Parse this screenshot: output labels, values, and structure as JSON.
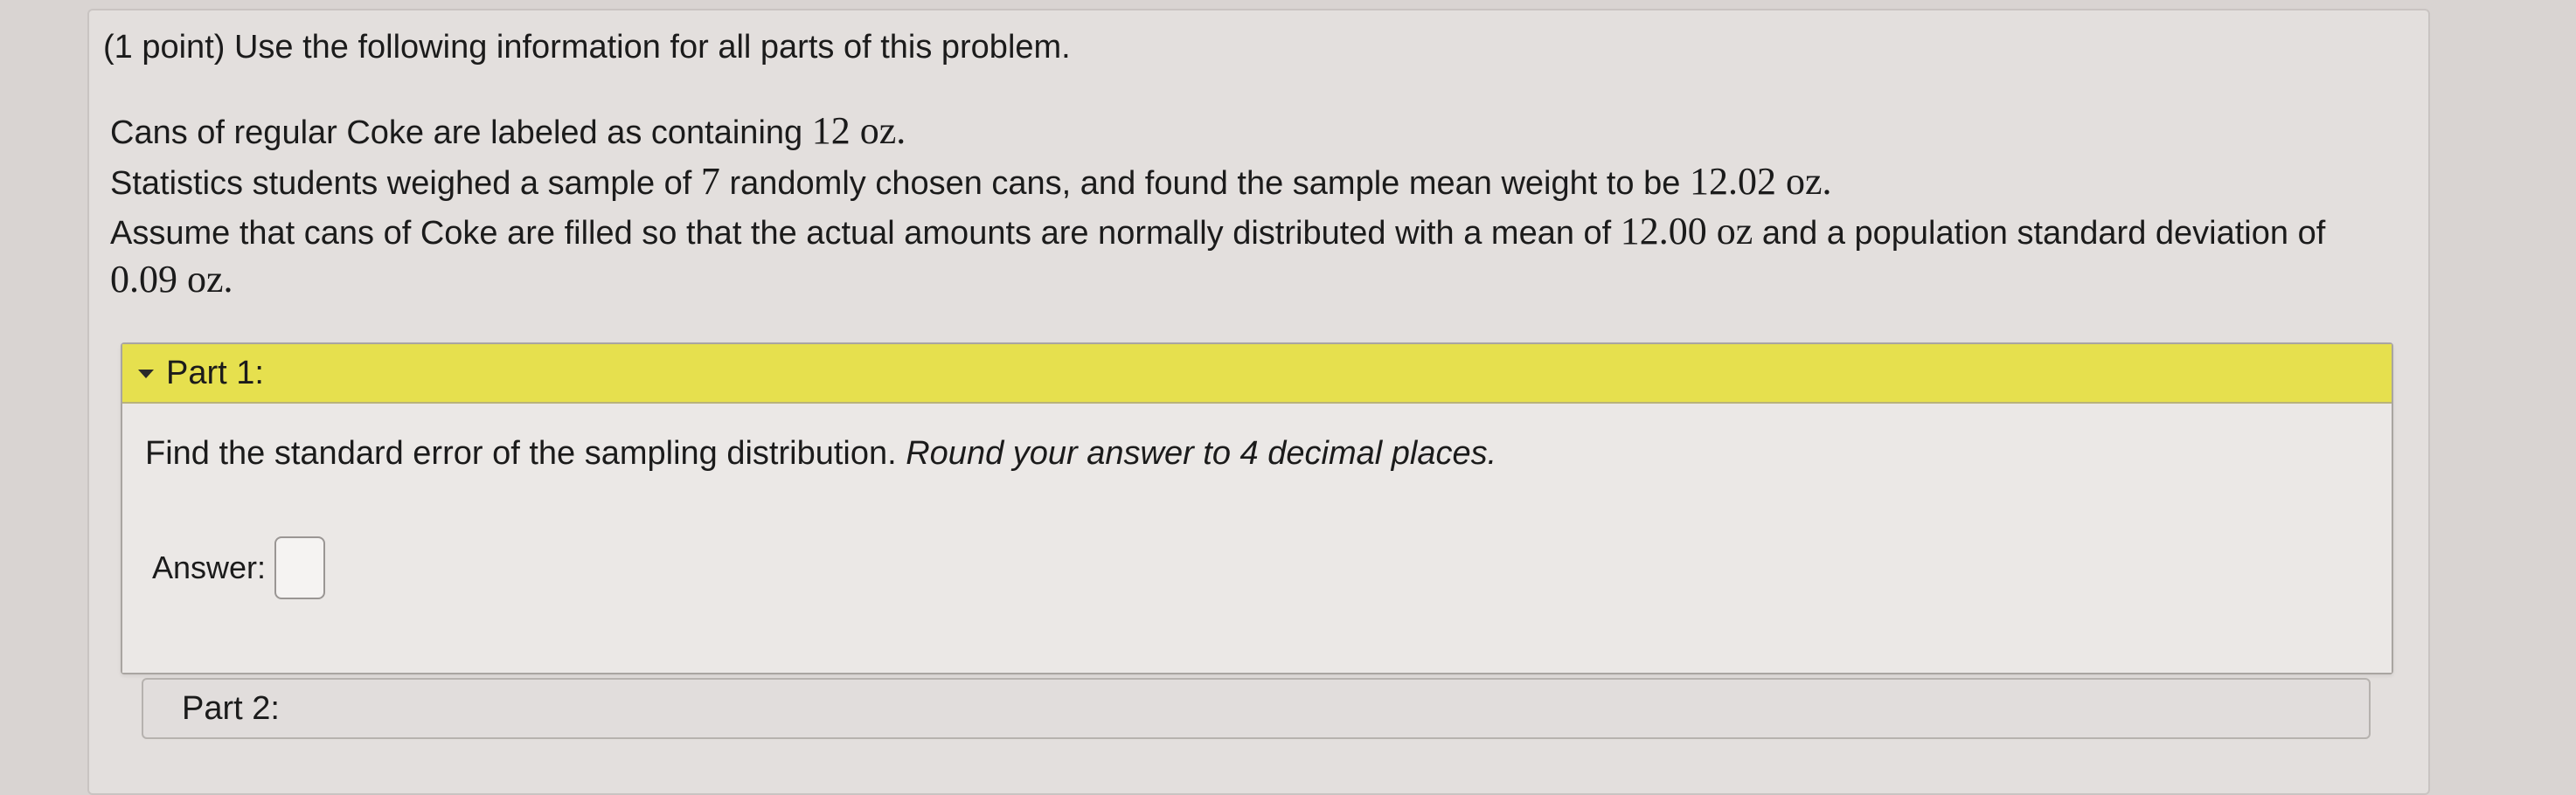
{
  "problem": {
    "intro": "(1 point) Use the following information for all parts of this problem.",
    "line1": {
      "text": "Cans of regular Coke are labeled as containing ",
      "value": "12 oz."
    },
    "line2": {
      "text_a": "Statistics students weighed a sample of ",
      "n": "7",
      "text_b": " randomly chosen cans, and found the sample mean weight to be ",
      "mean": "12.02 oz."
    },
    "line3": {
      "text_a": "Assume that cans of Coke are filled so that the actual amounts are normally distributed with a mean of ",
      "mu": "12.00 oz",
      "text_b": " and a population standard deviation of"
    },
    "line4": {
      "sigma": "0.09 oz."
    }
  },
  "part1": {
    "header": "Part 1:",
    "question": "Find the standard error of the sampling distribution. ",
    "instruction": "Round your answer to 4 decimal places.",
    "answer_label": "Answer:",
    "answer_value": ""
  },
  "part2": {
    "header": "Part 2:"
  }
}
